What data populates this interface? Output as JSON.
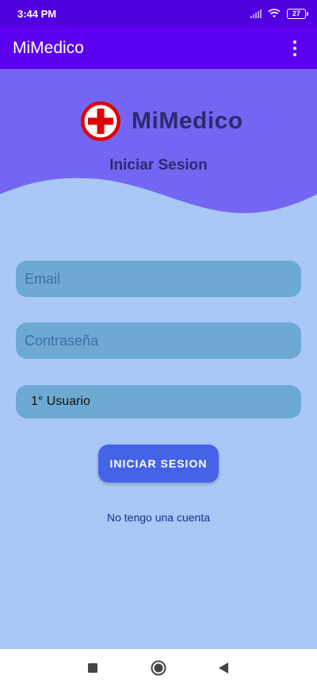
{
  "status_bar": {
    "time": "3:44 PM",
    "battery": "27"
  },
  "app_bar": {
    "title": "MiMedico",
    "menu_icon": "more-vert-icon"
  },
  "header": {
    "logo_text": "MiMedico",
    "subtitle": "Iniciar Sesion",
    "logo_icon": "red-cross-icon"
  },
  "form": {
    "email_placeholder": "Email",
    "email_value": "",
    "password_placeholder": "Contraseña",
    "password_value": "",
    "user_type_selected": "1° Usuario",
    "login_button_label": "INICIAR SESION",
    "register_link": "No tengo una cuenta"
  },
  "colors": {
    "status_bar": "#5100e0",
    "app_bar": "#5d00f2",
    "header_wave": "#7466f2",
    "background": "#a9c8f5",
    "field": "#6daad3",
    "button": "#4563e8"
  },
  "nav_bar": {
    "icons": [
      "recent-apps-icon",
      "home-icon",
      "back-icon"
    ]
  }
}
